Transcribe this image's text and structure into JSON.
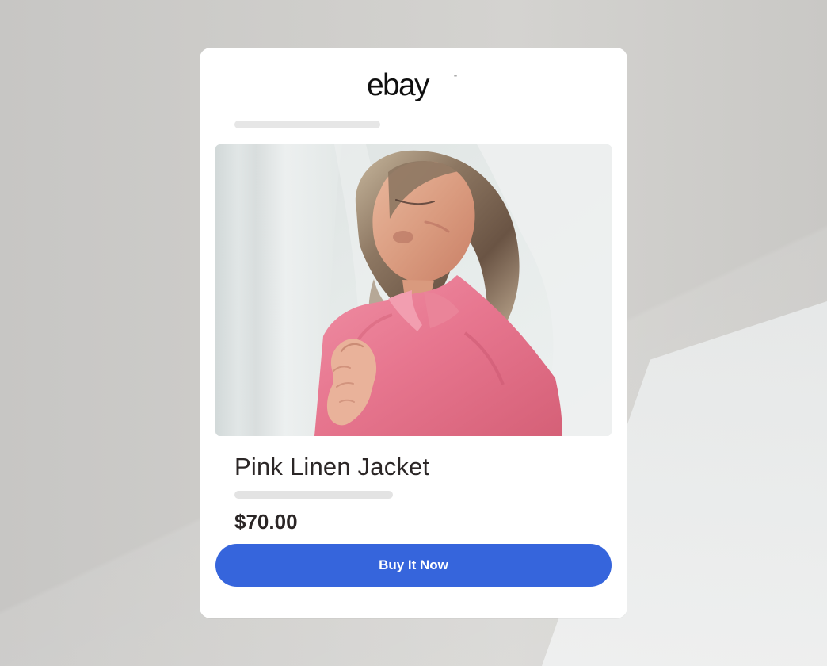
{
  "card": {
    "brand": "ebay",
    "title": "Pink Linen Jacket",
    "price": "$70.00",
    "cta_label": "Buy It Now"
  },
  "colors": {
    "page_background": "#cfcecb",
    "card_background": "#ffffff",
    "placeholder": "#e6e6e6",
    "text": "#2b2626",
    "button": "#3665dc",
    "button_text": "#ffffff"
  },
  "icons": {
    "brand_logo": "ebay-logo",
    "product_image": "woman-in-pink-jacket-photo"
  }
}
